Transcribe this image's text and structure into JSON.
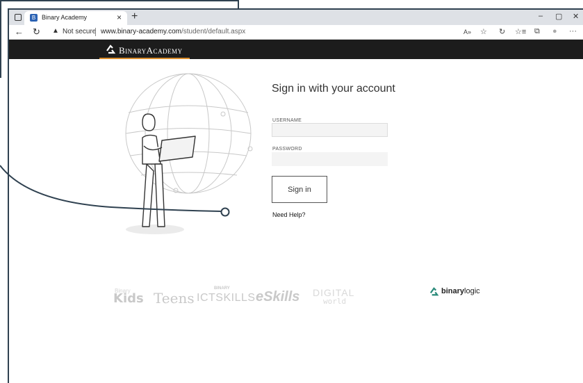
{
  "browser": {
    "tab_title": "Binary Academy",
    "tab_close": "×",
    "new_tab": "+",
    "fav_letter": "B",
    "security_text": "Not secure",
    "url_host": "www.binary-academy.com",
    "url_path": "/student/default.aspx",
    "window_controls": {
      "minimize": "–",
      "maximize": "▢",
      "close": "✕"
    },
    "nav": {
      "back": "←",
      "reload": "↻"
    },
    "toolbar_icons": {
      "read_aloud": "A»",
      "favorite": "☆",
      "refresh": "↻",
      "favorites": "☆≡",
      "collections": "⧉",
      "profile": "●",
      "more": "···"
    }
  },
  "site": {
    "brand": "BinaryAcademy",
    "accent": "#d98c2b"
  },
  "signin": {
    "title": "Sign in with your account",
    "username_label": "USERNAME",
    "username_value": "",
    "password_label": "PASSWORD",
    "password_value": "",
    "button_label": "Sign in",
    "help_link": "Need Help?"
  },
  "footer": {
    "brands": [
      "Kids",
      "Teens",
      "ICTSKILLS",
      "eSkills",
      "DIGITAL",
      "world"
    ],
    "ict_small": "BINARY",
    "kids_small": "Binary",
    "binarylogic_bold": "binary",
    "binarylogic_rest": "logic"
  }
}
